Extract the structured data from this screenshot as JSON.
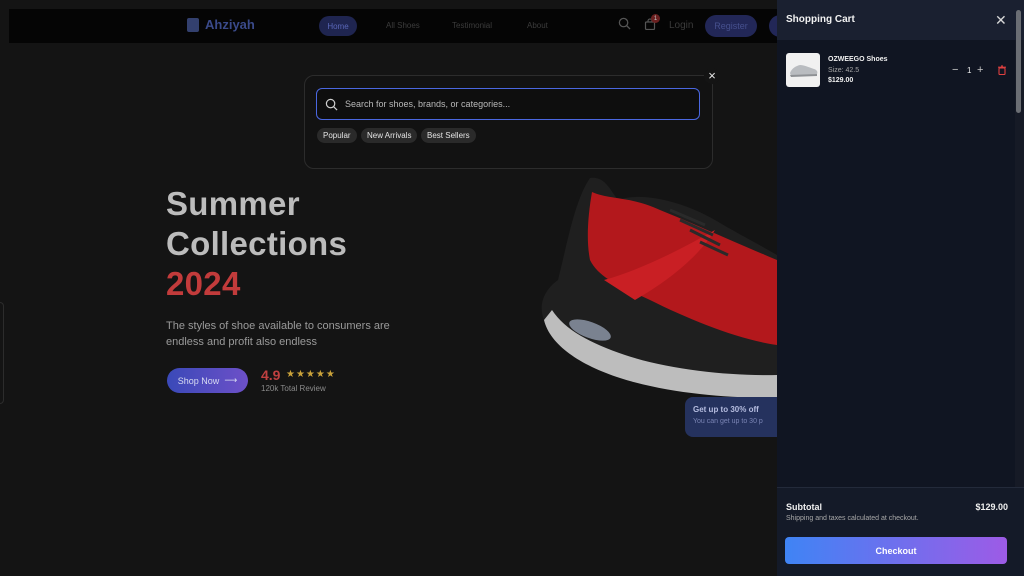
{
  "navbar": {
    "brand": "Ahziyah",
    "links": [
      "Home",
      "All Shoes",
      "Testimonial",
      "About"
    ],
    "cart_badge": "1",
    "login": "Login",
    "register": "Register"
  },
  "search": {
    "placeholder": "Search for shoes, brands, or categories...",
    "chips": [
      "Popular",
      "New Arrivals",
      "Best Sellers"
    ]
  },
  "hero": {
    "title_line1": "Summer",
    "title_line2": "Collections",
    "title_year": "2024",
    "description": "The styles of shoe available to consumers are endless and profit also endless",
    "cta": "Shop Now",
    "rating": "4.9",
    "stars": "★★★★★",
    "review_caption": "120k Total Review"
  },
  "promo": {
    "title": "Get up to 30% off",
    "subtitle": "You can get up to 30 p"
  },
  "cart": {
    "title": "Shopping Cart",
    "items": [
      {
        "name": "OZWEEGO Shoes",
        "size": "Size: 42.5",
        "price": "$129.00",
        "quantity": "1"
      }
    ],
    "subtotal_label": "Subtotal",
    "subtotal_value": "$129.00",
    "shipping_note": "Shipping and taxes calculated at checkout.",
    "checkout": "Checkout"
  },
  "colors": {
    "accent_blue": "#4a67e0",
    "hero_red": "#c23b3b",
    "checkout_start": "#3f84f5",
    "checkout_end": "#9d5be6"
  }
}
